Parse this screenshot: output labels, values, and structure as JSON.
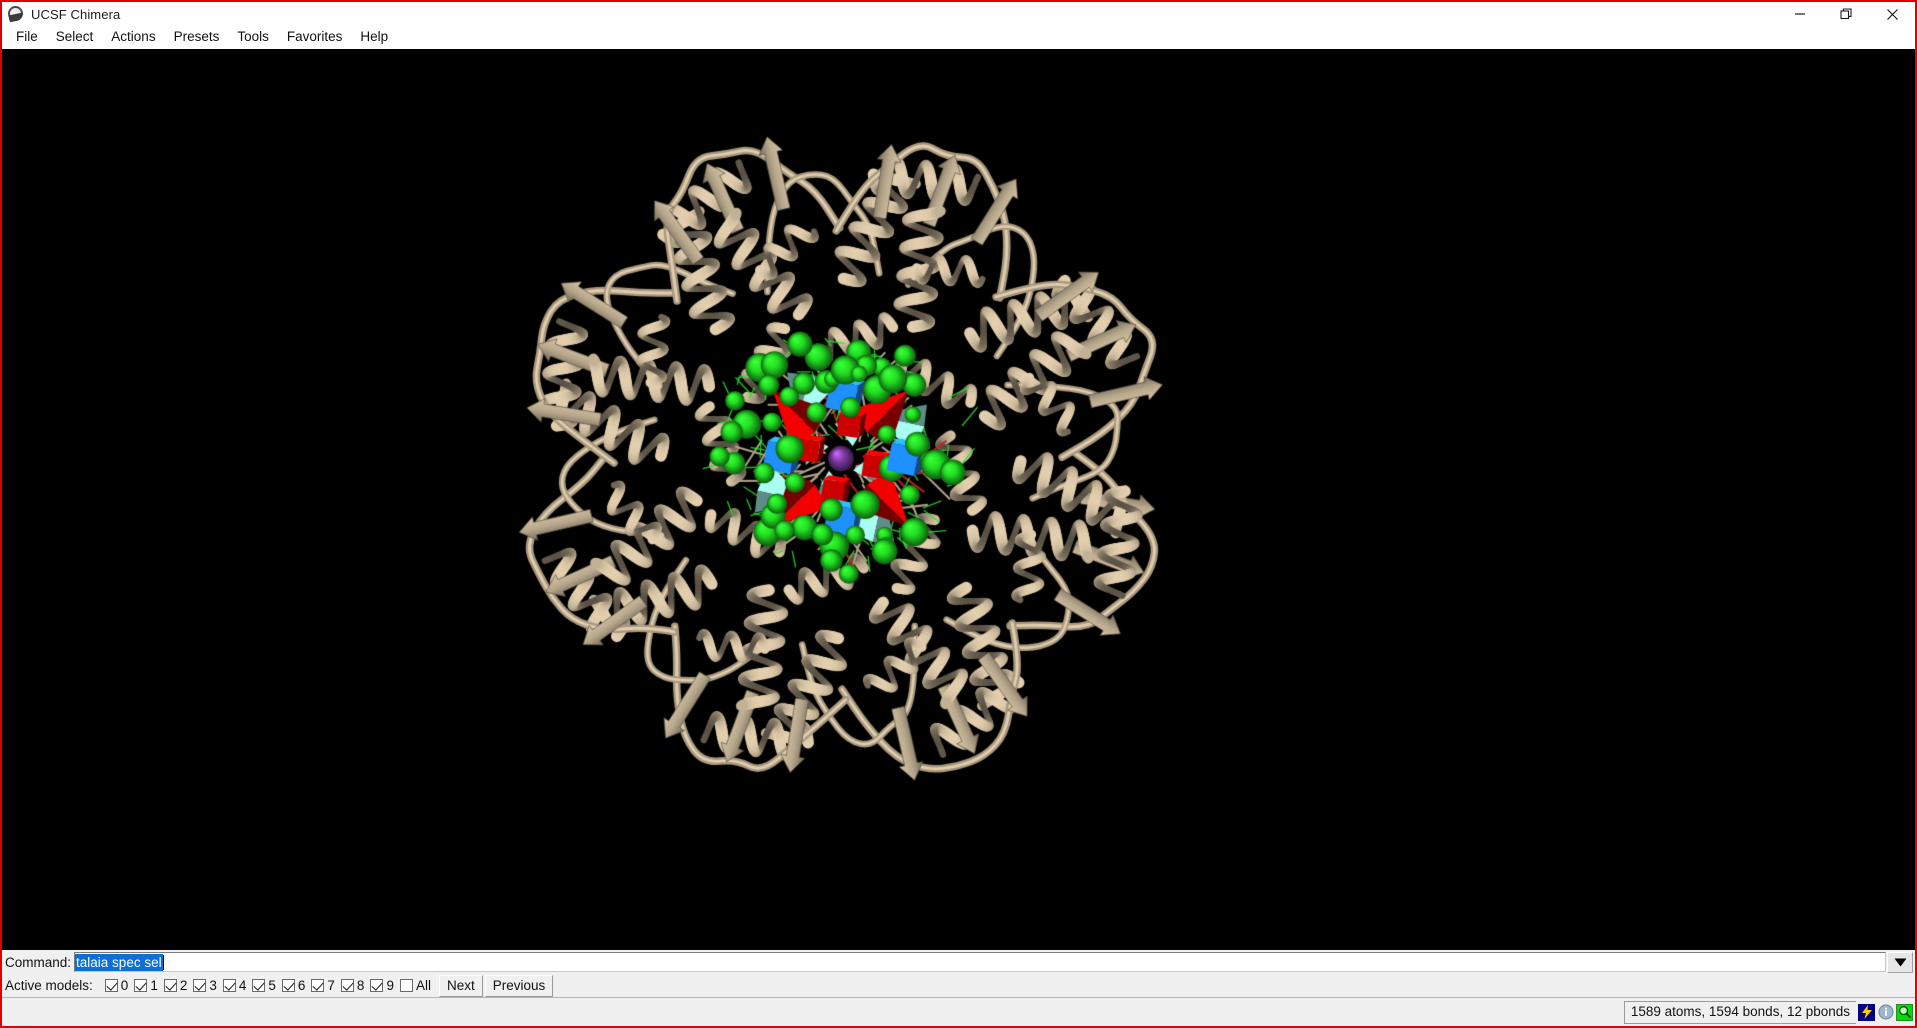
{
  "window": {
    "title": "UCSF Chimera",
    "app_icon": "chimera-logo-icon",
    "border_color": "#e00000",
    "controls": {
      "minimize": "minimize-icon",
      "restore": "restore-icon",
      "close": "close-icon"
    }
  },
  "menubar": {
    "items": [
      {
        "label": "File"
      },
      {
        "label": "Select"
      },
      {
        "label": "Actions"
      },
      {
        "label": "Presets"
      },
      {
        "label": "Tools"
      },
      {
        "label": "Favorites"
      },
      {
        "label": "Help"
      }
    ]
  },
  "viewport": {
    "background_color": "#000000",
    "scene": {
      "representation": "ribbon",
      "ribbon_color": "#d6c3a4",
      "description": "Ring-shaped multi-subunit protein assembly rendered as ribbons with a Talaia geometric-glyph pharmacophore display at the central pore",
      "glyphs": [
        {
          "shape": "sphere",
          "color": "#22dd22",
          "meaning": "hydrophobic-sphere-glyph"
        },
        {
          "shape": "cube",
          "color": "#1e90ff",
          "meaning": "positive-charge-cube-glyph"
        },
        {
          "shape": "cone",
          "color": "#cc0000",
          "meaning": "negative-charge-cone-glyph"
        },
        {
          "shape": "pyramid",
          "color": "#8fd6cc",
          "meaning": "polar-pyramid-glyph"
        },
        {
          "shape": "sphere",
          "color": "#7a3ba0",
          "meaning": "central-ion-sphere-glyph"
        }
      ]
    }
  },
  "command_bar": {
    "label": "Command:",
    "value": "talaia spec sel",
    "placeholder": "",
    "selected": true,
    "selection_color": "#0b6fd6",
    "dropdown_icon": "chevron-down-icon"
  },
  "active_models": {
    "label": "Active models:",
    "checkboxes": [
      {
        "label": "0",
        "checked": true
      },
      {
        "label": "1",
        "checked": true
      },
      {
        "label": "2",
        "checked": true
      },
      {
        "label": "3",
        "checked": true
      },
      {
        "label": "4",
        "checked": true
      },
      {
        "label": "5",
        "checked": true
      },
      {
        "label": "6",
        "checked": true
      },
      {
        "label": "7",
        "checked": true
      },
      {
        "label": "8",
        "checked": true
      },
      {
        "label": "9",
        "checked": true
      },
      {
        "label": "All",
        "checked": false
      }
    ],
    "next_label": "Next",
    "previous_label": "Previous"
  },
  "status_bar": {
    "text": "1589 atoms, 1594 bonds, 12 pbonds",
    "icons": [
      {
        "name": "lightning-icon",
        "color": "#ffd000",
        "background": "#000080"
      },
      {
        "name": "info-icon",
        "color": "#2b6cb0",
        "background": "#f0f0f0"
      },
      {
        "name": "magnifier-icon",
        "color": "#00e000",
        "background": "#00e000"
      }
    ]
  }
}
